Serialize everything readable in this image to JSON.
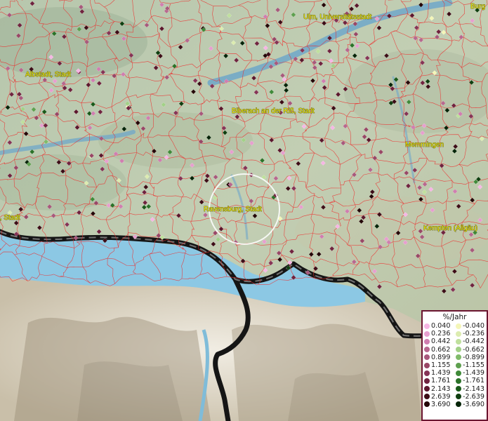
{
  "cities": [
    {
      "name": "Ulm, Universitätsstadt"
    },
    {
      "name": "Burg"
    },
    {
      "name": "Albstadt, Stadt"
    },
    {
      "name": "Biberach an der Riß, Stadt"
    },
    {
      "name": "Memmingen"
    },
    {
      "name": "Ravensburg, Stadt"
    },
    {
      "name": "Kempten (Allgäu)"
    },
    {
      "name": "I, Stadt"
    }
  ],
  "legend": {
    "title": "%/Jahr",
    "positive": [
      {
        "value": "0.040",
        "color": "#f6b6e4"
      },
      {
        "value": "0.236",
        "color": "#e79fcf"
      },
      {
        "value": "0.442",
        "color": "#d07eb0"
      },
      {
        "value": "0.662",
        "color": "#b8688f"
      },
      {
        "value": "0.899",
        "color": "#a8597c"
      },
      {
        "value": "1.155",
        "color": "#994766"
      },
      {
        "value": "1.439",
        "color": "#863456"
      },
      {
        "value": "1.761",
        "color": "#70233f"
      },
      {
        "value": "2.143",
        "color": "#5c172d"
      },
      {
        "value": "2.639",
        "color": "#3d0d17"
      },
      {
        "value": "3.690",
        "color": "#240708"
      }
    ],
    "negative": [
      {
        "value": "-0.040",
        "color": "#f4f6b8"
      },
      {
        "value": "-0.236",
        "color": "#dcecb0"
      },
      {
        "value": "-0.442",
        "color": "#bfe09d"
      },
      {
        "value": "-0.662",
        "color": "#a2d188"
      },
      {
        "value": "-0.899",
        "color": "#80bb6a"
      },
      {
        "value": "-1.155",
        "color": "#5ea04f"
      },
      {
        "value": "-1.439",
        "color": "#3f8a39"
      },
      {
        "value": "-1.761",
        "color": "#2b7228"
      },
      {
        "value": "-2.143",
        "color": "#1a5a1a"
      },
      {
        "value": "-2.639",
        "color": "#0f3f10"
      },
      {
        "value": "-3.690",
        "color": "#052408"
      }
    ]
  }
}
